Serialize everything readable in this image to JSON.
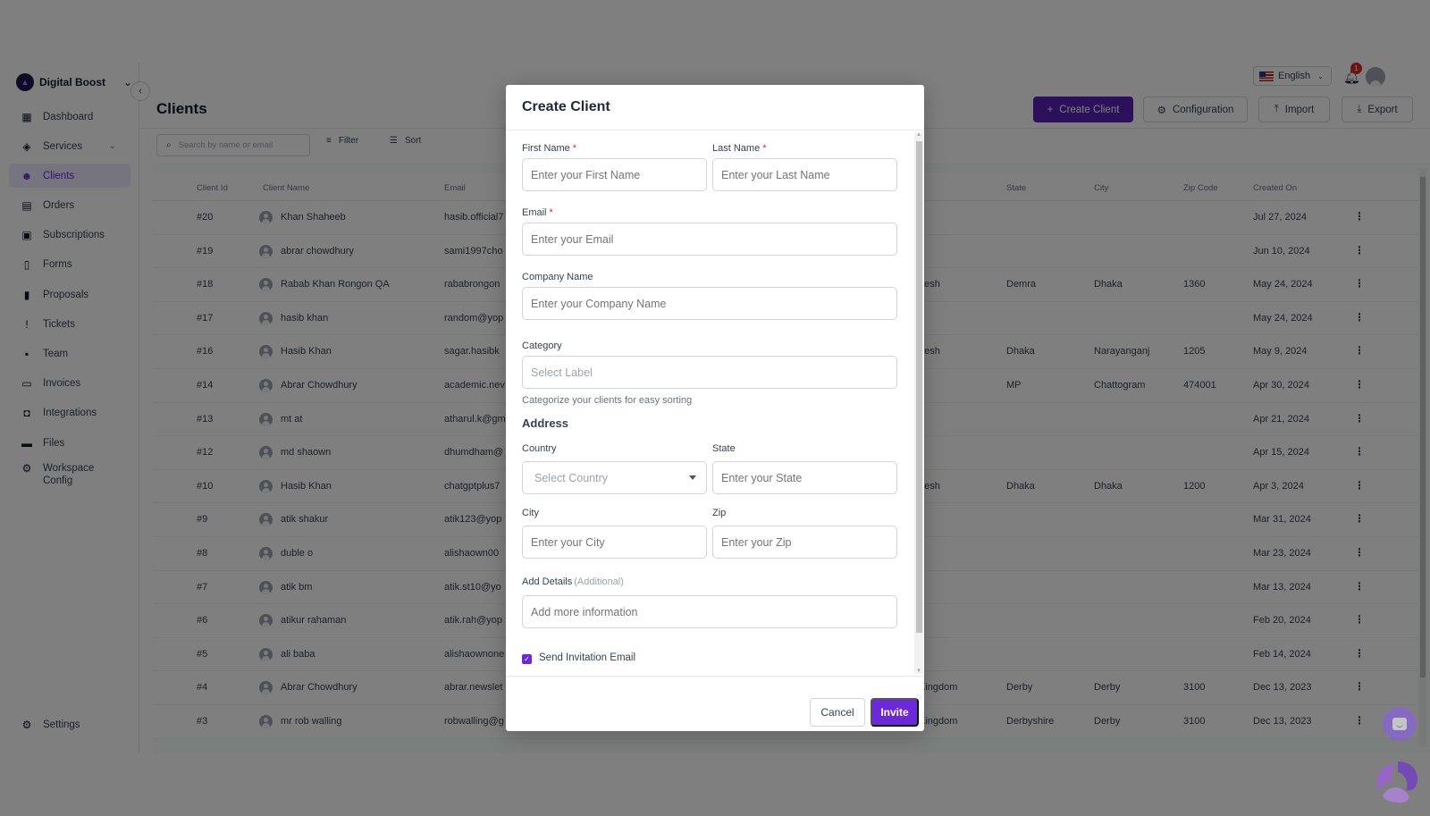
{
  "sidebar": {
    "workspace_name": "Digital Boost",
    "items": [
      {
        "label": "Dashboard",
        "icon": "dashboard-icon",
        "glyph": "▦"
      },
      {
        "label": "Services",
        "icon": "box-icon",
        "glyph": "◈",
        "has_children": true
      },
      {
        "label": "Clients",
        "icon": "clients-icon",
        "glyph": "☻",
        "active": true
      },
      {
        "label": "Orders",
        "icon": "orders-icon",
        "glyph": "▤"
      },
      {
        "label": "Subscriptions",
        "icon": "subscriptions-icon",
        "glyph": "▣"
      },
      {
        "label": "Forms",
        "icon": "forms-icon",
        "glyph": "▯"
      },
      {
        "label": "Proposals",
        "icon": "proposals-icon",
        "glyph": "▮"
      },
      {
        "label": "Tickets",
        "icon": "tickets-icon",
        "glyph": "!"
      },
      {
        "label": "Team",
        "icon": "team-icon",
        "glyph": "▪"
      },
      {
        "label": "Invoices",
        "icon": "invoices-icon",
        "glyph": "▭"
      },
      {
        "label": "Integrations",
        "icon": "integrations-icon",
        "glyph": "◘"
      },
      {
        "label": "Files",
        "icon": "files-icon",
        "glyph": "▬"
      },
      {
        "label": "Workspace Config",
        "icon": "workspace-config-icon",
        "glyph": "⚙"
      }
    ],
    "settings_label": "Settings"
  },
  "header": {
    "page_title": "Clients",
    "language": "English",
    "notification_count": "1",
    "buttons": {
      "create_client": "Create Client",
      "configuration": "Configuration",
      "import": "Import",
      "export": "Export"
    }
  },
  "toolbar": {
    "search_placeholder": "Search by name or email",
    "filter_label": "Filter",
    "sort_label": "Sort"
  },
  "table": {
    "columns": {
      "client_id": "Client Id",
      "client_name": "Client Name",
      "email": "Email",
      "state": "State",
      "city": "City",
      "zip_code": "Zip Code",
      "created_on": "Created On"
    },
    "rows": [
      {
        "id": "#20",
        "name": "Khan Shaheeb",
        "email": "hasib.official7",
        "country": "",
        "state": "",
        "city": "",
        "zip": "",
        "created": "Jul 27, 2024"
      },
      {
        "id": "#19",
        "name": "abrar chowdhury",
        "email": "sami1997cho",
        "country": "",
        "state": "",
        "city": "",
        "zip": "",
        "created": "Jun 10, 2024"
      },
      {
        "id": "#18",
        "name": "Rabab Khan Rongon QA",
        "email": "rababrongon",
        "country": "desh",
        "state": "Demra",
        "city": "Dhaka",
        "zip": "1360",
        "created": "May 24, 2024"
      },
      {
        "id": "#17",
        "name": "hasib khan",
        "email": "random@yop",
        "country": "",
        "state": "",
        "city": "",
        "zip": "",
        "created": "May 24, 2024"
      },
      {
        "id": "#16",
        "name": "Hasib Khan",
        "email": "sagar.hasibk",
        "country": "desh",
        "state": "Dhaka",
        "city": "Narayanganj",
        "zip": "1205",
        "created": "May 9, 2024"
      },
      {
        "id": "#14",
        "name": "Abrar Chowdhury",
        "email": "academic.nev",
        "country": "",
        "state": "MP",
        "city": "Chattogram",
        "zip": "474001",
        "created": "Apr 30, 2024"
      },
      {
        "id": "#13",
        "name": "mt at",
        "email": "atharul.k@gm",
        "country": "",
        "state": "",
        "city": "",
        "zip": "",
        "created": "Apr 21, 2024"
      },
      {
        "id": "#12",
        "name": "md shaown",
        "email": "dhumdham@",
        "country": "",
        "state": "",
        "city": "",
        "zip": "",
        "created": "Apr 15, 2024"
      },
      {
        "id": "#10",
        "name": "Hasib Khan",
        "email": "chatgptplus7",
        "country": "desh",
        "state": "Dhaka",
        "city": "Dhaka",
        "zip": "1200",
        "created": "Apr 3, 2024"
      },
      {
        "id": "#9",
        "name": "atik shakur",
        "email": "atik123@yop",
        "country": "",
        "state": "",
        "city": "",
        "zip": "",
        "created": "Mar 31, 2024"
      },
      {
        "id": "#8",
        "name": "duble o",
        "email": "alishaown00",
        "country": "",
        "state": "",
        "city": "",
        "zip": "",
        "created": "Mar 23, 2024"
      },
      {
        "id": "#7",
        "name": "atik bm",
        "email": "atik.st10@yo",
        "country": "",
        "state": "",
        "city": "",
        "zip": "",
        "created": "Mar 13, 2024"
      },
      {
        "id": "#6",
        "name": "atikur rahaman",
        "email": "atik.rah@yop",
        "country": "",
        "state": "",
        "city": "",
        "zip": "",
        "created": "Feb 20, 2024"
      },
      {
        "id": "#5",
        "name": "ali baba",
        "email": "alishaownone",
        "country": "",
        "state": "",
        "city": "",
        "zip": "",
        "created": "Feb 14, 2024"
      },
      {
        "id": "#4",
        "name": "Abrar Chowdhury",
        "email": "abrar.newslet",
        "country": "Kingdom",
        "state": "Derby",
        "city": "Derby",
        "zip": "3100",
        "created": "Dec 13, 2023"
      },
      {
        "id": "#3",
        "name": "mr rob walling",
        "email": "robwalling@g",
        "country": "Kingdom",
        "state": "Derbyshire",
        "city": "Derby",
        "zip": "3100",
        "created": "Dec 13, 2023"
      }
    ]
  },
  "modal": {
    "title": "Create Client",
    "fields": {
      "first_name": {
        "label": "First Name",
        "required": "*",
        "placeholder": "Enter your First Name",
        "value": ""
      },
      "last_name": {
        "label": "Last Name",
        "required": "*",
        "placeholder": "Enter your Last Name",
        "value": ""
      },
      "email": {
        "label": "Email",
        "required": "*",
        "placeholder": "Enter your Email",
        "value": ""
      },
      "company_name": {
        "label": "Company Name",
        "placeholder": "Enter your Company Name",
        "value": ""
      },
      "category": {
        "label": "Category",
        "placeholder": "Select Label",
        "helper": "Categorize your clients for easy sorting"
      },
      "country": {
        "label": "Country",
        "placeholder": "Select Country"
      },
      "state": {
        "label": "State",
        "placeholder": "Enter your State",
        "value": ""
      },
      "city": {
        "label": "City",
        "placeholder": "Enter your City",
        "value": ""
      },
      "zip": {
        "label": "Zip",
        "placeholder": "Enter your Zip",
        "value": ""
      },
      "details": {
        "label": "Add Details",
        "hint": "(Additional)",
        "placeholder": "Add more information",
        "value": ""
      }
    },
    "address_heading": "Address",
    "send_invitation": {
      "label": "Send Invitation Email",
      "checked": true
    },
    "cancel_label": "Cancel",
    "invite_label": "Invite"
  },
  "colors": {
    "primary": "#6d28d9",
    "primary_dark": "#5b21b6",
    "active_nav_bg": "#ede9fe",
    "required": "#dc2626",
    "chat_fab": "#8b5cf6"
  }
}
